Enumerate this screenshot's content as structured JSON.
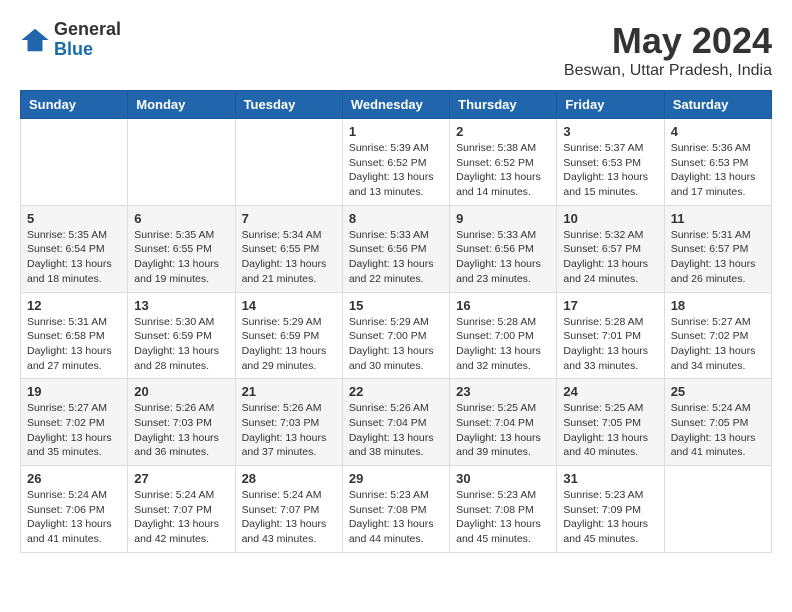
{
  "logo": {
    "general": "General",
    "blue": "Blue"
  },
  "title": "May 2024",
  "location": "Beswan, Uttar Pradesh, India",
  "weekdays": [
    "Sunday",
    "Monday",
    "Tuesday",
    "Wednesday",
    "Thursday",
    "Friday",
    "Saturday"
  ],
  "weeks": [
    [
      {
        "day": "",
        "info": ""
      },
      {
        "day": "",
        "info": ""
      },
      {
        "day": "",
        "info": ""
      },
      {
        "day": "1",
        "info": "Sunrise: 5:39 AM\nSunset: 6:52 PM\nDaylight: 13 hours\nand 13 minutes."
      },
      {
        "day": "2",
        "info": "Sunrise: 5:38 AM\nSunset: 6:52 PM\nDaylight: 13 hours\nand 14 minutes."
      },
      {
        "day": "3",
        "info": "Sunrise: 5:37 AM\nSunset: 6:53 PM\nDaylight: 13 hours\nand 15 minutes."
      },
      {
        "day": "4",
        "info": "Sunrise: 5:36 AM\nSunset: 6:53 PM\nDaylight: 13 hours\nand 17 minutes."
      }
    ],
    [
      {
        "day": "5",
        "info": "Sunrise: 5:35 AM\nSunset: 6:54 PM\nDaylight: 13 hours\nand 18 minutes."
      },
      {
        "day": "6",
        "info": "Sunrise: 5:35 AM\nSunset: 6:55 PM\nDaylight: 13 hours\nand 19 minutes."
      },
      {
        "day": "7",
        "info": "Sunrise: 5:34 AM\nSunset: 6:55 PM\nDaylight: 13 hours\nand 21 minutes."
      },
      {
        "day": "8",
        "info": "Sunrise: 5:33 AM\nSunset: 6:56 PM\nDaylight: 13 hours\nand 22 minutes."
      },
      {
        "day": "9",
        "info": "Sunrise: 5:33 AM\nSunset: 6:56 PM\nDaylight: 13 hours\nand 23 minutes."
      },
      {
        "day": "10",
        "info": "Sunrise: 5:32 AM\nSunset: 6:57 PM\nDaylight: 13 hours\nand 24 minutes."
      },
      {
        "day": "11",
        "info": "Sunrise: 5:31 AM\nSunset: 6:57 PM\nDaylight: 13 hours\nand 26 minutes."
      }
    ],
    [
      {
        "day": "12",
        "info": "Sunrise: 5:31 AM\nSunset: 6:58 PM\nDaylight: 13 hours\nand 27 minutes."
      },
      {
        "day": "13",
        "info": "Sunrise: 5:30 AM\nSunset: 6:59 PM\nDaylight: 13 hours\nand 28 minutes."
      },
      {
        "day": "14",
        "info": "Sunrise: 5:29 AM\nSunset: 6:59 PM\nDaylight: 13 hours\nand 29 minutes."
      },
      {
        "day": "15",
        "info": "Sunrise: 5:29 AM\nSunset: 7:00 PM\nDaylight: 13 hours\nand 30 minutes."
      },
      {
        "day": "16",
        "info": "Sunrise: 5:28 AM\nSunset: 7:00 PM\nDaylight: 13 hours\nand 32 minutes."
      },
      {
        "day": "17",
        "info": "Sunrise: 5:28 AM\nSunset: 7:01 PM\nDaylight: 13 hours\nand 33 minutes."
      },
      {
        "day": "18",
        "info": "Sunrise: 5:27 AM\nSunset: 7:02 PM\nDaylight: 13 hours\nand 34 minutes."
      }
    ],
    [
      {
        "day": "19",
        "info": "Sunrise: 5:27 AM\nSunset: 7:02 PM\nDaylight: 13 hours\nand 35 minutes."
      },
      {
        "day": "20",
        "info": "Sunrise: 5:26 AM\nSunset: 7:03 PM\nDaylight: 13 hours\nand 36 minutes."
      },
      {
        "day": "21",
        "info": "Sunrise: 5:26 AM\nSunset: 7:03 PM\nDaylight: 13 hours\nand 37 minutes."
      },
      {
        "day": "22",
        "info": "Sunrise: 5:26 AM\nSunset: 7:04 PM\nDaylight: 13 hours\nand 38 minutes."
      },
      {
        "day": "23",
        "info": "Sunrise: 5:25 AM\nSunset: 7:04 PM\nDaylight: 13 hours\nand 39 minutes."
      },
      {
        "day": "24",
        "info": "Sunrise: 5:25 AM\nSunset: 7:05 PM\nDaylight: 13 hours\nand 40 minutes."
      },
      {
        "day": "25",
        "info": "Sunrise: 5:24 AM\nSunset: 7:05 PM\nDaylight: 13 hours\nand 41 minutes."
      }
    ],
    [
      {
        "day": "26",
        "info": "Sunrise: 5:24 AM\nSunset: 7:06 PM\nDaylight: 13 hours\nand 41 minutes."
      },
      {
        "day": "27",
        "info": "Sunrise: 5:24 AM\nSunset: 7:07 PM\nDaylight: 13 hours\nand 42 minutes."
      },
      {
        "day": "28",
        "info": "Sunrise: 5:24 AM\nSunset: 7:07 PM\nDaylight: 13 hours\nand 43 minutes."
      },
      {
        "day": "29",
        "info": "Sunrise: 5:23 AM\nSunset: 7:08 PM\nDaylight: 13 hours\nand 44 minutes."
      },
      {
        "day": "30",
        "info": "Sunrise: 5:23 AM\nSunset: 7:08 PM\nDaylight: 13 hours\nand 45 minutes."
      },
      {
        "day": "31",
        "info": "Sunrise: 5:23 AM\nSunset: 7:09 PM\nDaylight: 13 hours\nand 45 minutes."
      },
      {
        "day": "",
        "info": ""
      }
    ]
  ]
}
